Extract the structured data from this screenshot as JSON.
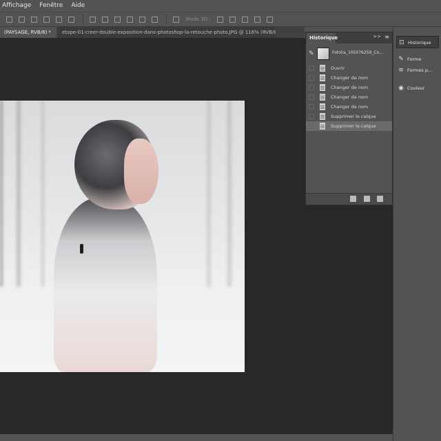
{
  "menubar": {
    "items": [
      "Affichage",
      "Fenêtre",
      "Aide"
    ]
  },
  "options_bar": {
    "mode_3d_label": "Mode 3D :"
  },
  "tabs": [
    {
      "label": "(PAYSAGE, RVB/8) *",
      "active": true
    },
    {
      "label": "etape-01-creer-double-exposition-dans-photoshop-la-retouche-photo.JPG @ 116% (RVB/8) *",
      "active": false
    }
  ],
  "close_glyph": "×",
  "history_panel": {
    "title": "Historique",
    "collapse_glyph": ">>",
    "menu_glyph": "≡",
    "snapshot": {
      "label": "Fotolia_105076259_Co...",
      "brush_glyph": "✎"
    },
    "rows": [
      {
        "label": "Ouvrir",
        "selected": false
      },
      {
        "label": "Changer de nom",
        "selected": false
      },
      {
        "label": "Changer de nom",
        "selected": false
      },
      {
        "label": "Changer de nom",
        "selected": false
      },
      {
        "label": "Changer de nom",
        "selected": false
      },
      {
        "label": "Supprimer le calque",
        "selected": false
      },
      {
        "label": "Supprimer le calque",
        "selected": true
      }
    ]
  },
  "dock": {
    "items": [
      {
        "label": "Historique",
        "icon": "history-icon",
        "glyph": "⊡",
        "active": true
      },
      {
        "label": "Forme",
        "icon": "brush-icon",
        "glyph": "✎",
        "active": false
      },
      {
        "label": "Formes p...",
        "icon": "brush-presets-icon",
        "glyph": "≡",
        "active": false
      },
      {
        "label": "Couleur",
        "icon": "color-palette-icon",
        "glyph": "◉",
        "active": false
      }
    ]
  }
}
